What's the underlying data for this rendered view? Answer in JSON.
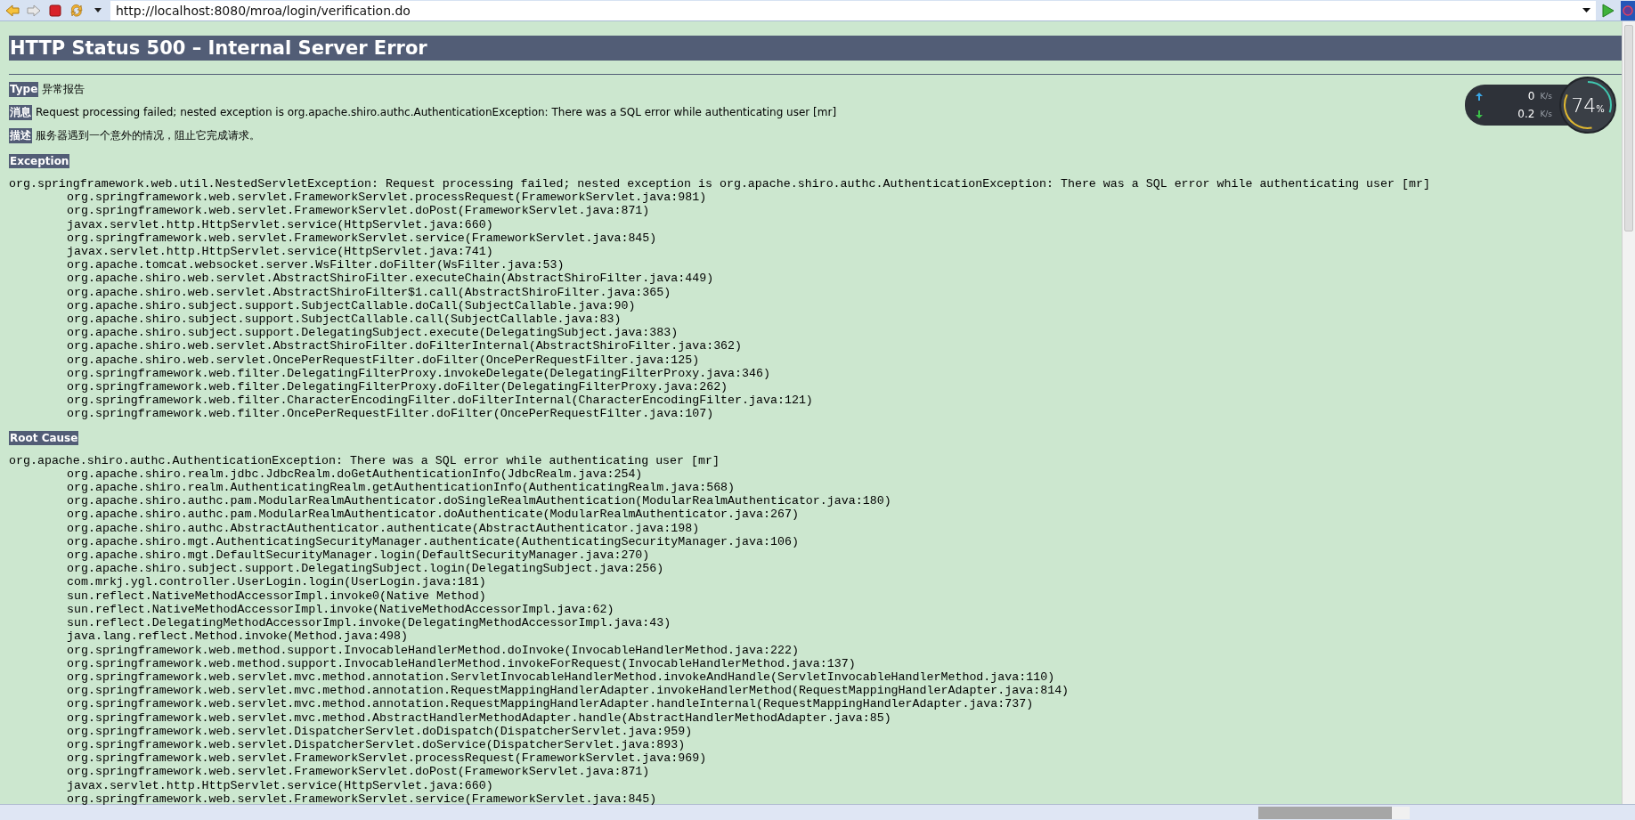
{
  "toolbar": {
    "url": "http://localhost:8080/mroa/login/verification.do"
  },
  "page": {
    "title": "HTTP Status 500 – Internal Server Error",
    "fields": [
      {
        "label": "Type",
        "value": "异常报告"
      },
      {
        "label": "消息",
        "value": "Request processing failed; nested exception is org.apache.shiro.authc.AuthenticationException: There was a SQL error while authenticating user [mr]"
      },
      {
        "label": "描述",
        "value": "服务器遇到一个意外的情况，阻止它完成请求。"
      }
    ],
    "sections": [
      {
        "heading": "Exception",
        "exception": "org.springframework.web.util.NestedServletException: Request processing failed; nested exception is org.apache.shiro.authc.AuthenticationException: There was a SQL error while authenticating user [mr]",
        "frames": [
          "org.springframework.web.servlet.FrameworkServlet.processRequest(FrameworkServlet.java:981)",
          "org.springframework.web.servlet.FrameworkServlet.doPost(FrameworkServlet.java:871)",
          "javax.servlet.http.HttpServlet.service(HttpServlet.java:660)",
          "org.springframework.web.servlet.FrameworkServlet.service(FrameworkServlet.java:845)",
          "javax.servlet.http.HttpServlet.service(HttpServlet.java:741)",
          "org.apache.tomcat.websocket.server.WsFilter.doFilter(WsFilter.java:53)",
          "org.apache.shiro.web.servlet.AbstractShiroFilter.executeChain(AbstractShiroFilter.java:449)",
          "org.apache.shiro.web.servlet.AbstractShiroFilter$1.call(AbstractShiroFilter.java:365)",
          "org.apache.shiro.subject.support.SubjectCallable.doCall(SubjectCallable.java:90)",
          "org.apache.shiro.subject.support.SubjectCallable.call(SubjectCallable.java:83)",
          "org.apache.shiro.subject.support.DelegatingSubject.execute(DelegatingSubject.java:383)",
          "org.apache.shiro.web.servlet.AbstractShiroFilter.doFilterInternal(AbstractShiroFilter.java:362)",
          "org.apache.shiro.web.servlet.OncePerRequestFilter.doFilter(OncePerRequestFilter.java:125)",
          "org.springframework.web.filter.DelegatingFilterProxy.invokeDelegate(DelegatingFilterProxy.java:346)",
          "org.springframework.web.filter.DelegatingFilterProxy.doFilter(DelegatingFilterProxy.java:262)",
          "org.springframework.web.filter.CharacterEncodingFilter.doFilterInternal(CharacterEncodingFilter.java:121)",
          "org.springframework.web.filter.OncePerRequestFilter.doFilter(OncePerRequestFilter.java:107)"
        ]
      },
      {
        "heading": "Root Cause",
        "exception": "org.apache.shiro.authc.AuthenticationException: There was a SQL error while authenticating user [mr]",
        "frames": [
          "org.apache.shiro.realm.jdbc.JdbcRealm.doGetAuthenticationInfo(JdbcRealm.java:254)",
          "org.apache.shiro.realm.AuthenticatingRealm.getAuthenticationInfo(AuthenticatingRealm.java:568)",
          "org.apache.shiro.authc.pam.ModularRealmAuthenticator.doSingleRealmAuthentication(ModularRealmAuthenticator.java:180)",
          "org.apache.shiro.authc.pam.ModularRealmAuthenticator.doAuthenticate(ModularRealmAuthenticator.java:267)",
          "org.apache.shiro.authc.AbstractAuthenticator.authenticate(AbstractAuthenticator.java:198)",
          "org.apache.shiro.mgt.AuthenticatingSecurityManager.authenticate(AuthenticatingSecurityManager.java:106)",
          "org.apache.shiro.mgt.DefaultSecurityManager.login(DefaultSecurityManager.java:270)",
          "org.apache.shiro.subject.support.DelegatingSubject.login(DelegatingSubject.java:256)",
          "com.mrkj.ygl.controller.UserLogin.login(UserLogin.java:181)",
          "sun.reflect.NativeMethodAccessorImpl.invoke0(Native Method)",
          "sun.reflect.NativeMethodAccessorImpl.invoke(NativeMethodAccessorImpl.java:62)",
          "sun.reflect.DelegatingMethodAccessorImpl.invoke(DelegatingMethodAccessorImpl.java:43)",
          "java.lang.reflect.Method.invoke(Method.java:498)",
          "org.springframework.web.method.support.InvocableHandlerMethod.doInvoke(InvocableHandlerMethod.java:222)",
          "org.springframework.web.method.support.InvocableHandlerMethod.invokeForRequest(InvocableHandlerMethod.java:137)",
          "org.springframework.web.servlet.mvc.method.annotation.ServletInvocableHandlerMethod.invokeAndHandle(ServletInvocableHandlerMethod.java:110)",
          "org.springframework.web.servlet.mvc.method.annotation.RequestMappingHandlerAdapter.invokeHandlerMethod(RequestMappingHandlerAdapter.java:814)",
          "org.springframework.web.servlet.mvc.method.annotation.RequestMappingHandlerAdapter.handleInternal(RequestMappingHandlerAdapter.java:737)",
          "org.springframework.web.servlet.mvc.method.AbstractHandlerMethodAdapter.handle(AbstractHandlerMethodAdapter.java:85)",
          "org.springframework.web.servlet.DispatcherServlet.doDispatch(DispatcherServlet.java:959)",
          "org.springframework.web.servlet.DispatcherServlet.doService(DispatcherServlet.java:893)",
          "org.springframework.web.servlet.FrameworkServlet.processRequest(FrameworkServlet.java:969)",
          "org.springframework.web.servlet.FrameworkServlet.doPost(FrameworkServlet.java:871)",
          "javax.servlet.http.HttpServlet.service(HttpServlet.java:660)",
          "org.springframework.web.servlet.FrameworkServlet.service(FrameworkServlet.java:845)"
        ]
      }
    ]
  },
  "speed_widget": {
    "upload": "0",
    "upload_unit": "K/s",
    "download": "0.2",
    "download_unit": "K/s",
    "percent": "74",
    "percent_sign": "%"
  }
}
